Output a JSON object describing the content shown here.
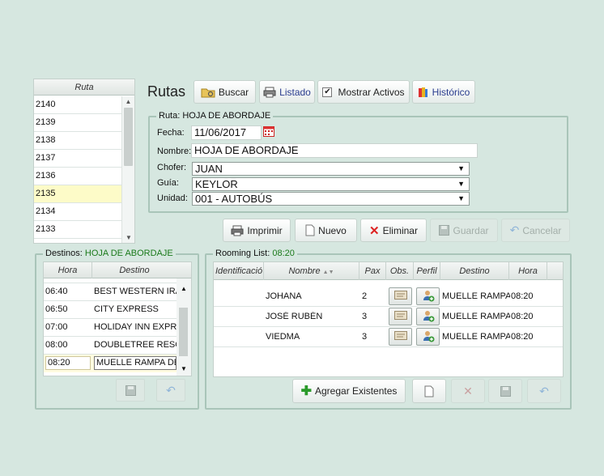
{
  "route_list": {
    "header": "Ruta",
    "items": [
      "2140",
      "2139",
      "2138",
      "2137",
      "2136",
      "2135",
      "2134",
      "2133"
    ],
    "selected_index": 5
  },
  "header": {
    "title": "Rutas",
    "buscar": "Buscar",
    "listado": "Listado",
    "mostrar_activos": "Mostrar Activos",
    "mostrar_activos_checked": true,
    "historico": "Histórico"
  },
  "ruta_form": {
    "legend_prefix": "Ruta:",
    "legend_value": "HOJA DE ABORDAJE",
    "fecha_label": "Fecha:",
    "fecha_value": "11/06/2017",
    "nombre_label": "Nombre:",
    "nombre_value": "HOJA DE ABORDAJE",
    "chofer_label": "Chofer:",
    "chofer_value": "JUAN",
    "guia_label": "Guía:",
    "guia_value": "KEYLOR",
    "unidad_label": "Unidad:",
    "unidad_value": "001 - AUTOBÚS"
  },
  "actions": {
    "imprimir": "Imprimir",
    "nuevo": "Nuevo",
    "eliminar": "Eliminar",
    "guardar": "Guardar",
    "cancelar": "Cancelar"
  },
  "destinos": {
    "legend_prefix": "Destinos:",
    "legend_value": "HOJA DE ABORDAJE",
    "col_hora": "Hora",
    "col_destino": "Destino",
    "rows": [
      {
        "hora": "06:40",
        "destino": "BEST WESTERN IRAZ"
      },
      {
        "hora": "06:50",
        "destino": "CITY EXPRESS"
      },
      {
        "hora": "07:00",
        "destino": "HOLIDAY INN EXPRE"
      },
      {
        "hora": "08:00",
        "destino": "DOUBLETREE RESOR"
      }
    ],
    "edit_hora": "08:20",
    "edit_destino": "MUELLE RAMPA DE"
  },
  "rooming": {
    "legend_prefix": "Rooming List:",
    "legend_value": "08:20",
    "col_identificacion": "Identificació",
    "col_nombre": "Nombre",
    "col_pax": "Pax",
    "col_obs": "Obs.",
    "col_perfil": "Perfil",
    "col_destino": "Destino",
    "col_hora": "Hora",
    "rows": [
      {
        "id": "",
        "nombre": "JOHANA",
        "pax": "2",
        "destino": "MUELLE RAMPA",
        "hora": "08:20"
      },
      {
        "id": "",
        "nombre": "JOSÉ RUBÉN",
        "pax": "3",
        "destino": "MUELLE RAMPA",
        "hora": "08:20"
      },
      {
        "id": "",
        "nombre": "VIEDMA",
        "pax": "3",
        "destino": "MUELLE RAMPA",
        "hora": "08:20"
      }
    ],
    "agregar": "Agregar Existentes"
  }
}
